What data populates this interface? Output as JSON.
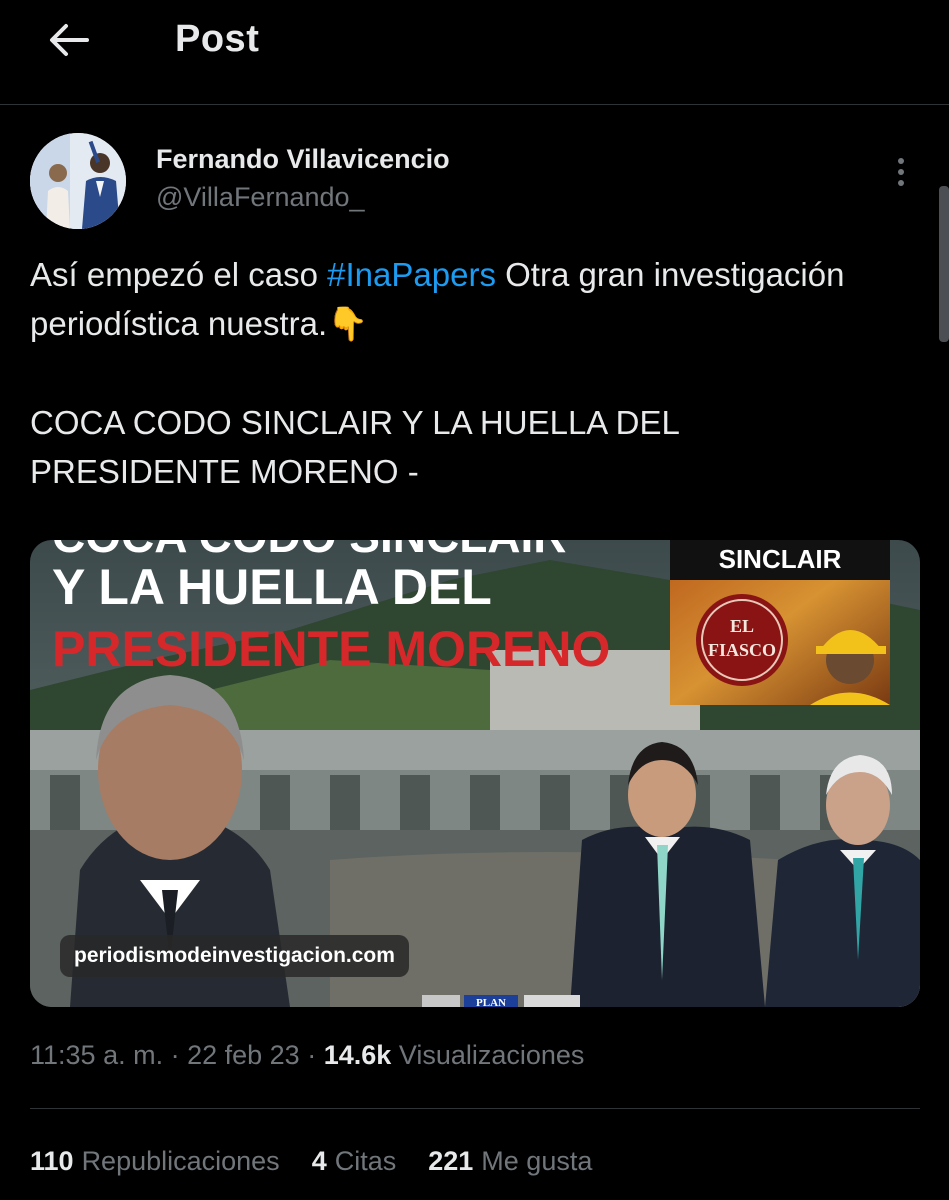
{
  "header": {
    "title": "Post",
    "back_icon": "arrow-left-icon"
  },
  "tweet": {
    "author_name": "Fernando Villavicencio",
    "author_handle": "@VillaFernando_",
    "text_before_hashtag": "Así empezó el caso ",
    "hashtag": "#InaPapers",
    "text_after_hashtag": " Otra gran investigación periodística nuestra.",
    "emoji": "👇",
    "headline_line1": "COCA CODO SINCLAIR Y LA HUELLA DEL",
    "headline_line2": "PRESIDENTE MORENO -"
  },
  "media": {
    "title_partial": "COCA CODO SINCLAIR",
    "title_line1": "Y LA HUELLA DEL",
    "title_line2": "PRESIDENTE MORENO",
    "inset_label": "SINCLAIR",
    "stamp_line1": "EL",
    "stamp_line2": "FIASCO",
    "url": "periodismodeinvestigacion.com",
    "logo_text": "PLAN"
  },
  "meta": {
    "time": "11:35 a. m.",
    "date": "22 feb 23",
    "views_count": "14.6k",
    "views_label": "Visualizaciones"
  },
  "stats": {
    "reposts_count": "110",
    "reposts_label": "Republicaciones",
    "quotes_count": "4",
    "quotes_label": "Citas",
    "likes_count": "221",
    "likes_label": "Me gusta"
  },
  "colors": {
    "background": "#000000",
    "text": "#e7e9ea",
    "muted": "#71767b",
    "link": "#1d9bf0",
    "title_red": "#d6282b"
  }
}
